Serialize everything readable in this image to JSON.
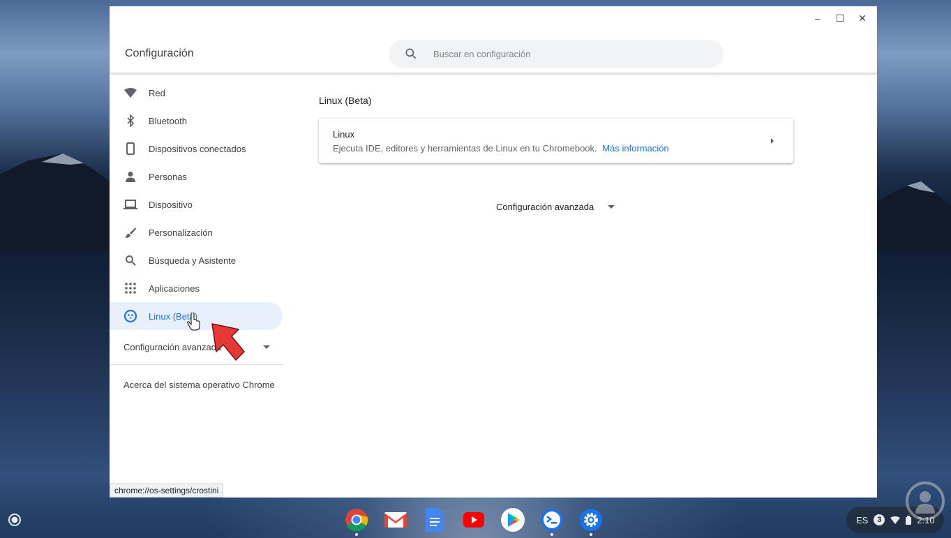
{
  "window": {
    "title": "Configuración",
    "controls": {
      "minimize": "–",
      "maximize": "☐",
      "close": "✕"
    }
  },
  "search": {
    "placeholder": "Buscar en configuración",
    "icon": "search-icon"
  },
  "sidebar": {
    "items": [
      {
        "label": "Red",
        "icon": "wifi-icon"
      },
      {
        "label": "Bluetooth",
        "icon": "bluetooth-icon"
      },
      {
        "label": "Dispositivos conectados",
        "icon": "phone-icon"
      },
      {
        "label": "Personas",
        "icon": "person-icon"
      },
      {
        "label": "Dispositivo",
        "icon": "laptop-icon"
      },
      {
        "label": "Personalización",
        "icon": "brush-icon"
      },
      {
        "label": "Búsqueda y Asistente",
        "icon": "search-icon"
      },
      {
        "label": "Aplicaciones",
        "icon": "apps-grid-icon"
      },
      {
        "label": "Linux (Beta)",
        "icon": "penguin-icon",
        "active": true
      }
    ],
    "advanced": "Configuración avanzada",
    "about": "Acerca del sistema operativo Chrome"
  },
  "main": {
    "section_title": "Linux (Beta)",
    "card": {
      "title": "Linux",
      "description": "Ejecuta IDE, editores y herramientas de Linux en tu Chromebook.",
      "link": "Más información"
    },
    "advanced": "Configuración avanzada"
  },
  "status_url": "chrome://os-settings/crostini",
  "shelf": {
    "apps": [
      "chrome-icon",
      "gmail-icon",
      "docs-icon",
      "youtube-icon",
      "play-store-icon",
      "linux-terminal-icon",
      "settings-icon"
    ],
    "tray": {
      "lang": "ES",
      "notifications": "3",
      "time": "2:10"
    }
  },
  "colors": {
    "accent": "#1a73e8",
    "active_bg": "#e8f0fe",
    "text": "#3c4043"
  }
}
